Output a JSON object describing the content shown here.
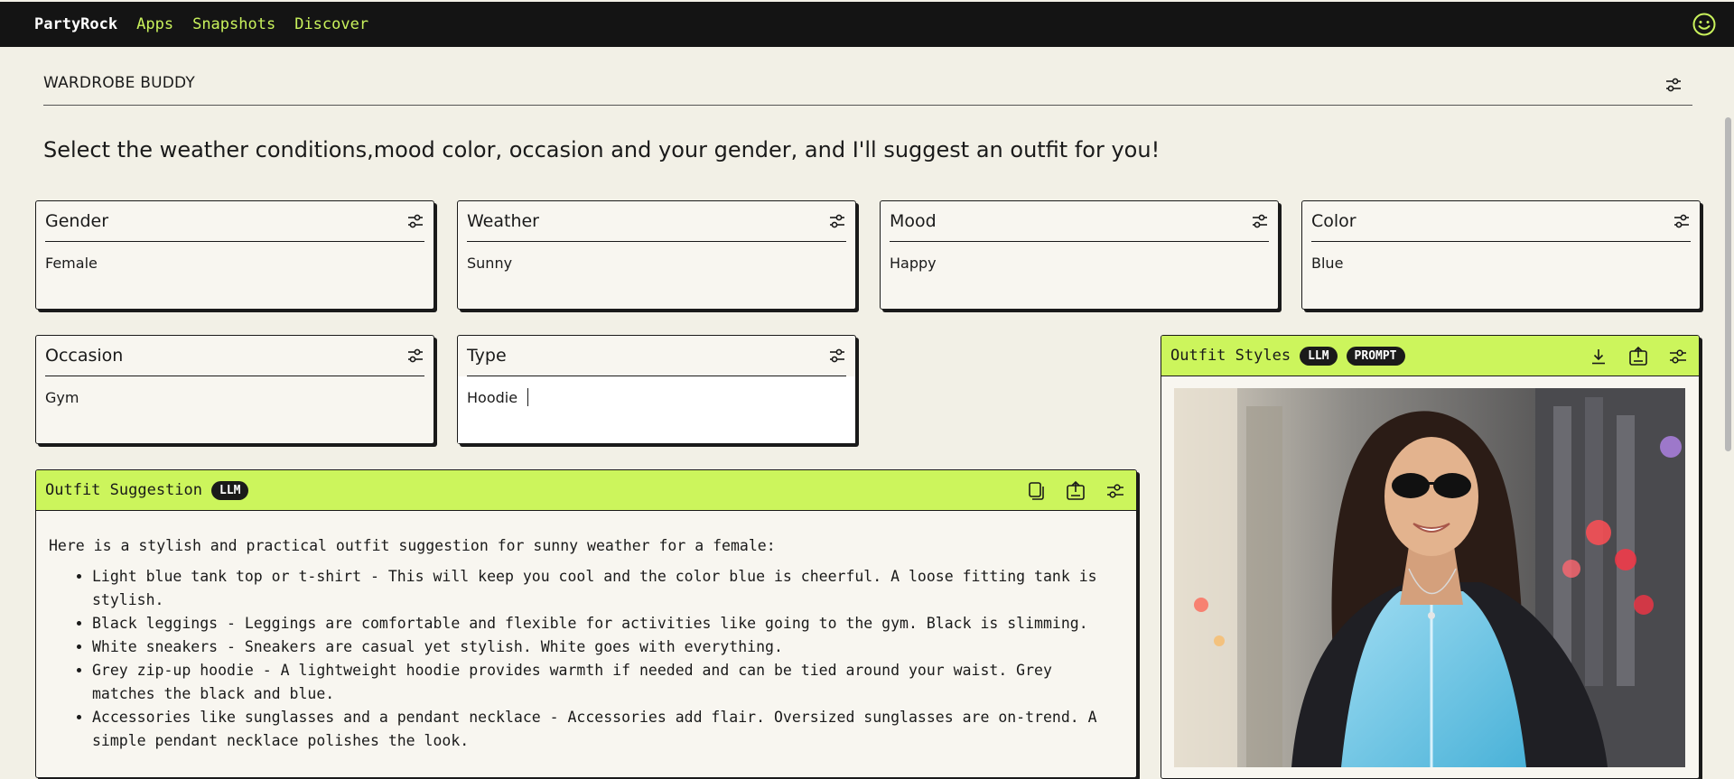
{
  "nav": {
    "brand": "PartyRock",
    "links": [
      "Apps",
      "Snapshots",
      "Discover"
    ]
  },
  "app": {
    "title": "WARDROBE BUDDY",
    "headline": "Select the weather conditions,mood color, occasion and your gender, and I'll suggest an outfit for you!"
  },
  "inputs": [
    {
      "label": "Gender",
      "value": "Female"
    },
    {
      "label": "Weather",
      "value": "Sunny"
    },
    {
      "label": "Mood",
      "value": "Happy"
    },
    {
      "label": "Color",
      "value": "Blue"
    },
    {
      "label": "Occasion",
      "value": "Gym"
    },
    {
      "label": "Type",
      "value": "Hoodie"
    }
  ],
  "outfit_suggestion": {
    "title": "Outfit Suggestion",
    "badge": "LLM",
    "intro": "Here is a stylish and practical outfit suggestion for sunny weather for a female:",
    "items": [
      "Light blue tank top or t-shirt - This will keep you cool and the color blue is cheerful. A loose fitting tank is stylish.",
      "Black leggings - Leggings are comfortable and flexible for activities like going to the gym. Black is slimming.",
      "White sneakers - Sneakers are casual yet stylish. White goes with everything.",
      "Grey zip-up hoodie - A lightweight hoodie provides warmth if needed and can be tied around your waist. Grey matches the black and blue.",
      "Accessories like sunglasses and a pendant necklace - Accessories add flair. Oversized sunglasses are on-trend. A simple pendant necklace polishes the look."
    ]
  },
  "outfit_styles": {
    "title": "Outfit Styles",
    "badges": [
      "LLM",
      "PROMPT"
    ],
    "image_desc": "Smiling woman with sunglasses wearing a light blue zip-up hoodie on a city street"
  },
  "colors": {
    "nav_bg": "#141414",
    "accent": "#ccf55c",
    "page_bg": "#f2f0e6"
  }
}
